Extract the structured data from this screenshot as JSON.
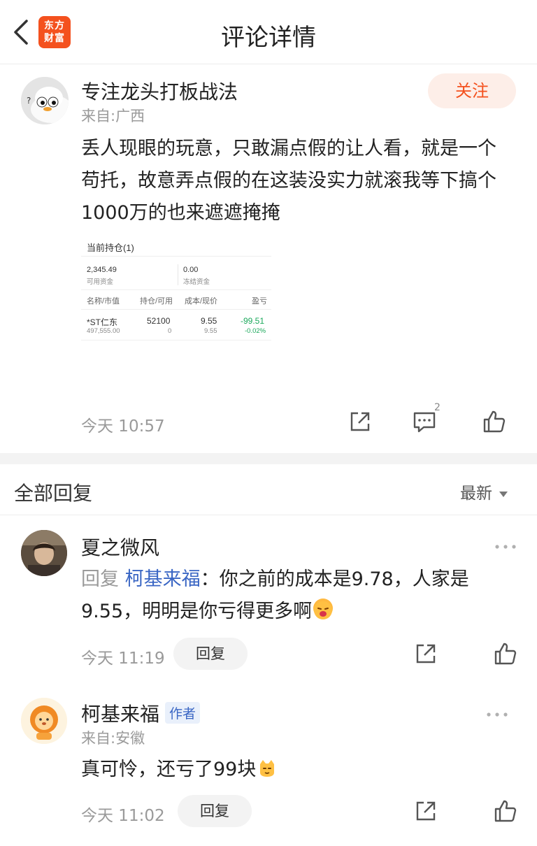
{
  "header": {
    "title": "评论详情",
    "logo_text_line1": "东方",
    "logo_text_line2": "财富"
  },
  "post": {
    "username": "专注龙头打板战法",
    "location": "来自:广西",
    "follow_label": "关注",
    "text": "丢人现眼的玩意，只敢漏点假的让人看，就是一个苟托，故意弄点假的在这装没实力就滚我等下搞个1000万的也来遮遮掩掩",
    "card": {
      "title": "当前持仓(1)",
      "available_value": "2,345.49",
      "available_label": "可用资金",
      "frozen_value": "0.00",
      "frozen_label": "冻结资金",
      "headers": [
        "名称/市值",
        "持仓/可用",
        "成本/现价",
        "盈亏"
      ],
      "row": {
        "name": "*ST仁东",
        "market_value": "497,555.00",
        "holding": "52100",
        "available": "0",
        "cost": "9.55",
        "price": "9.55",
        "pnl": "-99.51",
        "pnl_pct": "-0.02%"
      }
    },
    "time": "今天 10:57",
    "comment_count": "2"
  },
  "replies_section": {
    "title": "全部回复",
    "sort_label": "最新"
  },
  "replies": [
    {
      "username": "夏之微风",
      "prefix": "回复",
      "reply_to": "柯基来福",
      "colon": "：",
      "text": "你之前的成本是9.78，人家是9.55，明明是你亏得更多啊",
      "time": "今天 11:19",
      "reply_label": "回复"
    },
    {
      "username": "柯基来福",
      "author_badge": "作者",
      "location": "来自:安徽",
      "text": "真可怜，还亏了99块",
      "time": "今天 11:02",
      "reply_label": "回复"
    }
  ],
  "colors": {
    "brand": "#f4511e",
    "link": "#3a66c4",
    "gain_loss": "#19a85a"
  }
}
